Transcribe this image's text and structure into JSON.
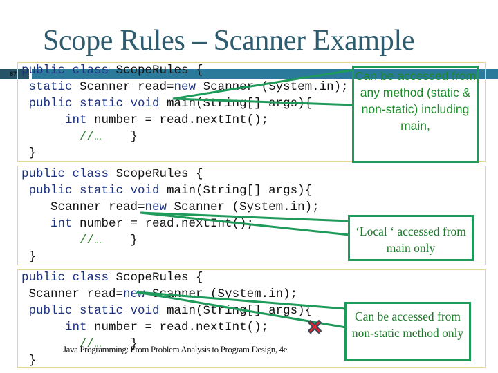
{
  "slide": {
    "title": "Scope Rules – Scanner Example",
    "page_number": "87",
    "footer": "Java Programming: From Problem Analysis to Program Design, 4e"
  },
  "examples": [
    {
      "lines": [
        [
          {
            "t": "public class ",
            "k": "kw"
          },
          {
            "t": "ScopeRules {",
            "k": ""
          }
        ],
        [
          {
            "t": " static ",
            "k": "kw"
          },
          {
            "t": "Scanner read=",
            "k": ""
          },
          {
            "t": "new ",
            "k": "kw"
          },
          {
            "t": "Scanner (System.in);",
            "k": ""
          }
        ],
        [
          {
            "t": " public static void ",
            "k": "kw"
          },
          {
            "t": "main(String[] args){",
            "k": ""
          }
        ],
        [
          {
            "t": "      int ",
            "k": "kw"
          },
          {
            "t": "number = read.nextInt();",
            "k": ""
          }
        ],
        [
          {
            "t": "        //…",
            "k": "cm"
          },
          {
            "t": "    }",
            "k": ""
          }
        ],
        [
          {
            "t": " }",
            "k": ""
          }
        ]
      ],
      "callout": "Can be accessed from any method (static & non-static) including main,"
    },
    {
      "lines": [
        [
          {
            "t": "public class ",
            "k": "kw"
          },
          {
            "t": "ScopeRules {",
            "k": ""
          }
        ],
        [
          {
            "t": " public static void ",
            "k": "kw"
          },
          {
            "t": "main(String[] args){",
            "k": ""
          }
        ],
        [
          {
            "t": "    Scanner read=",
            "k": ""
          },
          {
            "t": "new ",
            "k": "kw"
          },
          {
            "t": "Scanner (System.in);",
            "k": ""
          }
        ],
        [
          {
            "t": "    int ",
            "k": "kw"
          },
          {
            "t": "number = read.nextInt();",
            "k": ""
          }
        ],
        [
          {
            "t": "        //…",
            "k": "cm"
          },
          {
            "t": "    }",
            "k": ""
          }
        ],
        [
          {
            "t": " }",
            "k": ""
          }
        ]
      ],
      "callout": "‘Local ‘ accessed from main only"
    },
    {
      "lines": [
        [
          {
            "t": "public class ",
            "k": "kw"
          },
          {
            "t": "ScopeRules {",
            "k": ""
          }
        ],
        [
          {
            "t": " Scanner read=",
            "k": ""
          },
          {
            "t": "new ",
            "k": "kw"
          },
          {
            "t": "Scanner (System.in);",
            "k": ""
          }
        ],
        [
          {
            "t": " public static void ",
            "k": "kw"
          },
          {
            "t": "main(String[] args){",
            "k": ""
          }
        ],
        [
          {
            "t": "      int ",
            "k": "kw"
          },
          {
            "t": "number = read.nextInt();",
            "k": ""
          }
        ],
        [
          {
            "t": "        //…",
            "k": "cm"
          },
          {
            "t": "    }",
            "k": ""
          }
        ],
        [
          {
            "t": " }",
            "k": ""
          }
        ]
      ],
      "callout": "Can be accessed from non-static method only"
    }
  ],
  "icons": {
    "error_mark": "x-icon"
  },
  "colors": {
    "title": "#2e5c6e",
    "accent_bar": "#2b7a9c",
    "callout_border": "#1e9a5a",
    "callout_text": "#1c7a2a",
    "keyword": "#1c3280",
    "comment": "#2f7d2f",
    "error_mark": "#e8202a"
  }
}
